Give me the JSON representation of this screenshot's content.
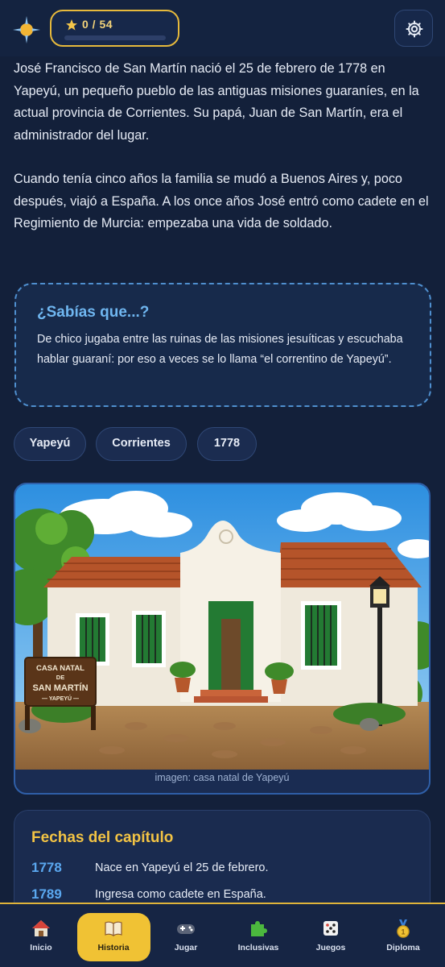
{
  "header": {
    "logo_icon": "compass-star-icon",
    "score": {
      "icon": "star-icon",
      "label": "0 / 54",
      "progress_fraction": 0
    },
    "settings_icon": "gear-icon"
  },
  "article": {
    "paragraphs": [
      "José Francisco de San Martín nació el 25 de febrero de 1778 en Yapeyú, un pequeño pueblo de las antiguas misiones guaraníes, en la actual provincia de Corrientes. Su papá, Juan de San Martín, era el administrador del lugar.",
      "Cuando tenía cinco años la familia se mudó a Buenos Aires y, poco después, viajó a España. A los once años José entró como cadete en el Regimiento de Murcia: empezaba una vida de soldado."
    ],
    "fact": {
      "title": "¿Sabías que...?",
      "text": "De chico jugaba entre las ruinas de las misiones jesuíticas y escuchaba hablar guaraní: por eso a veces se lo llama “el correntino de Yapeyú”."
    },
    "tags": [
      "Yapeyú",
      "Corrientes",
      "1778"
    ],
    "image": {
      "sign_lines": [
        "CASA NATAL",
        "DE",
        "SAN MARTÍN",
        "— YAPEYÚ —"
      ],
      "caption": "imagen: casa natal de Yapeyú"
    },
    "dates": {
      "title": "Fechas del capítulo",
      "rows": [
        {
          "year": "1778",
          "text": "Nace en Yapeyú el 25 de febrero."
        },
        {
          "year": "1789",
          "text": "Ingresa como cadete en España."
        }
      ]
    }
  },
  "nav": {
    "active": "Historia",
    "items": [
      {
        "label": "Inicio",
        "icon": "house-icon"
      },
      {
        "label": "Historia",
        "icon": "book-icon"
      },
      {
        "label": "Jugar",
        "icon": "gamepad-icon"
      },
      {
        "label": "Inclusivas",
        "icon": "puzzle-icon"
      },
      {
        "label": "Juegos",
        "icon": "dice-icon"
      },
      {
        "label": "Diploma",
        "icon": "medal-icon"
      }
    ]
  },
  "colors": {
    "background": "#13203a",
    "accent_gold": "#f0c234",
    "accent_blue": "#5aa7ef"
  }
}
